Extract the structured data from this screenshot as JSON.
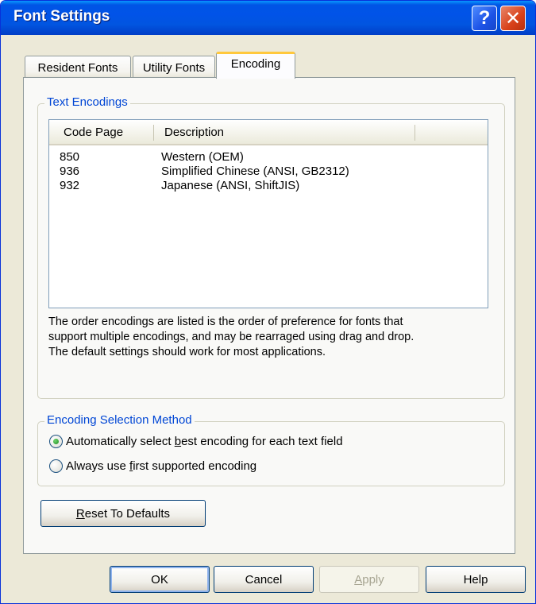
{
  "window": {
    "title": "Font Settings",
    "help_glyph": "?",
    "close_glyph": "✕"
  },
  "tabs": [
    {
      "label": "Resident Fonts",
      "active": false
    },
    {
      "label": "Utility Fonts",
      "active": false
    },
    {
      "label": "Encoding",
      "active": true
    }
  ],
  "text_encodings": {
    "group_label": "Text Encodings",
    "columns": [
      "Code Page",
      "Description"
    ],
    "rows": [
      {
        "code_page": "850",
        "description": "Western (OEM)"
      },
      {
        "code_page": "936",
        "description": "Simplified Chinese (ANSI, GB2312)"
      },
      {
        "code_page": "932",
        "description": "Japanese (ANSI, ShiftJIS)"
      }
    ],
    "note_lines": [
      "The order encodings are listed is the order of preference for fonts that",
      "support multiple encodings, and may be rearraged using drag and drop.",
      "The default settings should work for most applications."
    ]
  },
  "selection_method": {
    "group_label": "Encoding Selection Method",
    "options": [
      {
        "pre": "Automatically select ",
        "key": "b",
        "post": "est encoding for each text field",
        "checked": true
      },
      {
        "pre": "Always use ",
        "key": "f",
        "post": "irst supported encoding",
        "checked": false
      }
    ]
  },
  "reset_button": {
    "pre": "",
    "key": "R",
    "post": "eset To Defaults"
  },
  "footer_buttons": {
    "ok": "OK",
    "cancel": "Cancel",
    "apply_key": "A",
    "apply_rest": "pply",
    "help": "Help"
  },
  "colors": {
    "title_bar": "#0153e8",
    "group_label": "#0046d5",
    "active_tab_accent": "#ffc83c",
    "radio_checked": "#1f8d1f"
  }
}
